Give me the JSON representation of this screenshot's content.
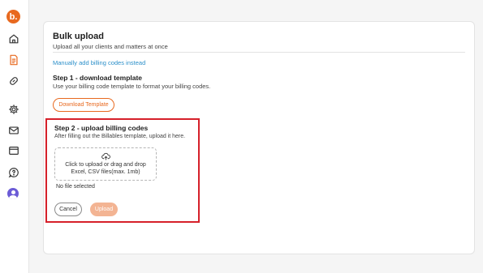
{
  "brand": {
    "logo_letter": "b.",
    "accent_color": "#e8691f",
    "highlight_color": "#d6202a"
  },
  "sidebar": {
    "items": [
      {
        "icon": "home-icon"
      },
      {
        "icon": "document-icon",
        "active": true
      },
      {
        "icon": "link-icon"
      },
      {
        "icon": "gear-icon"
      },
      {
        "icon": "mail-icon"
      },
      {
        "icon": "browser-window-icon"
      },
      {
        "icon": "help-chat-icon"
      },
      {
        "icon": "user-avatar-icon"
      }
    ]
  },
  "page": {
    "title": "Bulk upload",
    "subtitle": "Upload all your clients and matters at once",
    "manual_link": "Manually add billing codes instead"
  },
  "step1": {
    "title": "Step 1 - download template",
    "description": "Use your billing code template to format your billing codes.",
    "button_label": "Download Template"
  },
  "step2": {
    "title": "Step 2 - upload billing codes",
    "description": "After filling out the Billables template, upload it here.",
    "dropzone_line1": "Click to upload or drag and drop",
    "dropzone_line2": "Excel, CSV files(max. 1mb)",
    "file_status": "No file selected",
    "cancel_label": "Cancel",
    "upload_label": "Upload"
  }
}
